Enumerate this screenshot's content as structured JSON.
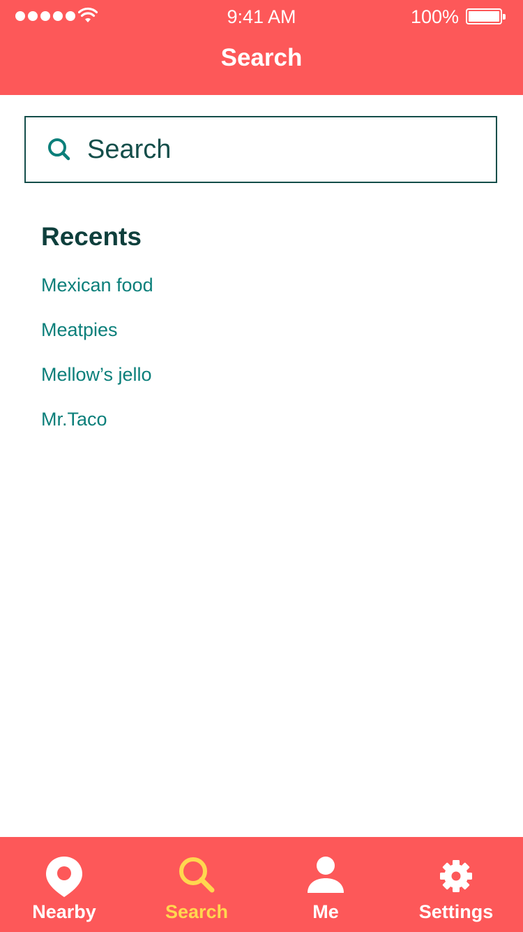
{
  "status_bar": {
    "time": "9:41 AM",
    "battery_percent": "100%",
    "signal_icon": "signal-dots-icon",
    "wifi_icon": "wifi-icon",
    "battery_icon": "battery-icon"
  },
  "header": {
    "title": "Search",
    "background_color": "#fd5859"
  },
  "search": {
    "placeholder": "Search",
    "value": "",
    "icon": "search-icon",
    "border_color": "#144e4a"
  },
  "recents": {
    "title": "Recents",
    "items": [
      {
        "label": "Mexican food"
      },
      {
        "label": "Meatpies"
      },
      {
        "label": "Mellow’s jello"
      },
      {
        "label": "Mr.Taco"
      }
    ],
    "link_color": "#0b7f7a"
  },
  "tab_bar": {
    "active_color": "#ffd74f",
    "inactive_color": "#ffffff",
    "tabs": [
      {
        "label": "Nearby",
        "icon": "location-pin-icon",
        "active": false
      },
      {
        "label": "Search",
        "icon": "search-icon",
        "active": true
      },
      {
        "label": "Me",
        "icon": "user-icon",
        "active": false
      },
      {
        "label": "Settings",
        "icon": "gear-icon",
        "active": false
      }
    ]
  }
}
